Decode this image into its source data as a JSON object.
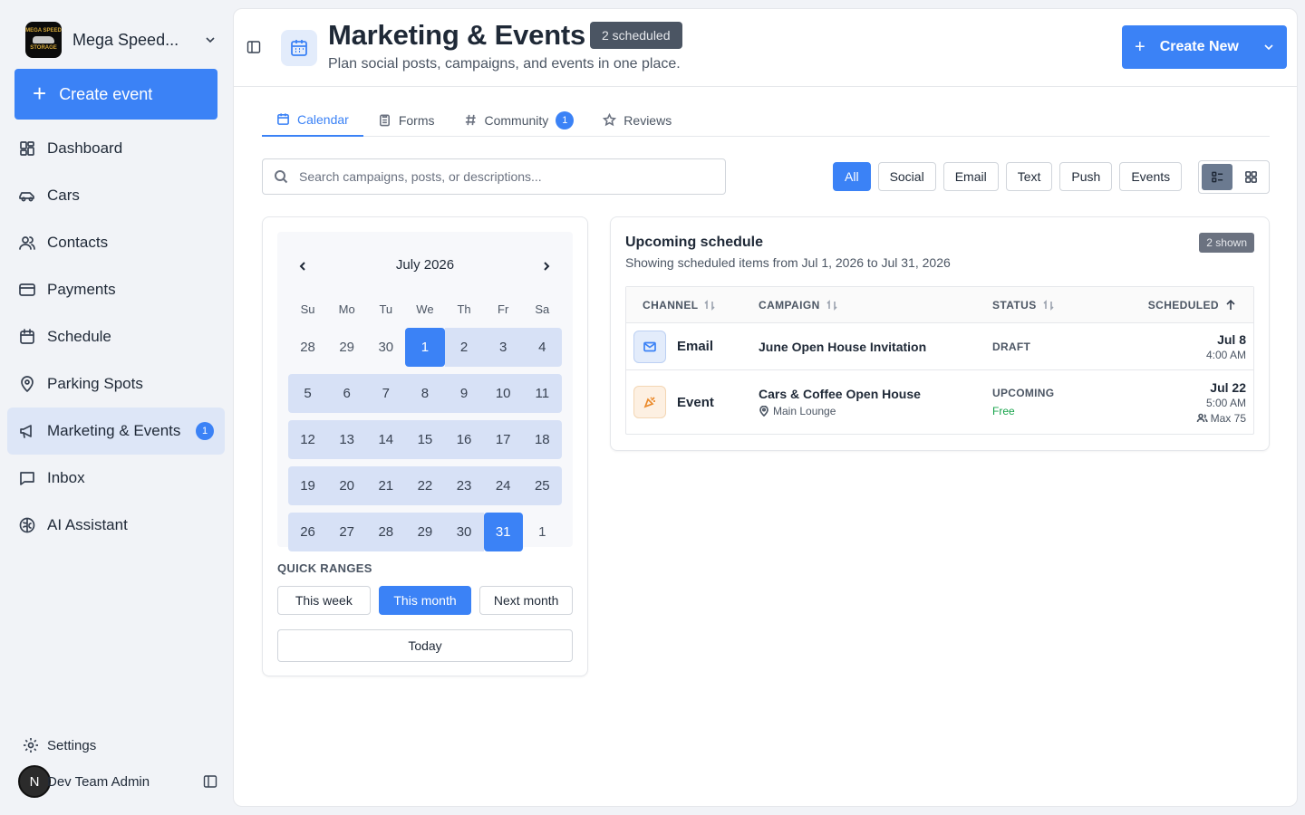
{
  "brand": {
    "name": "Mega Speed...",
    "logo_text_top": "MEGA SPEED",
    "logo_text_bottom": "STORAGE"
  },
  "sidebar": {
    "create_label": "Create event",
    "items": [
      {
        "label": "Dashboard",
        "icon": "dashboard-icon"
      },
      {
        "label": "Cars",
        "icon": "car-icon"
      },
      {
        "label": "Contacts",
        "icon": "contacts-icon"
      },
      {
        "label": "Payments",
        "icon": "credit-card-icon"
      },
      {
        "label": "Schedule",
        "icon": "calendar-icon"
      },
      {
        "label": "Parking Spots",
        "icon": "map-pin-icon"
      },
      {
        "label": "Marketing & Events",
        "icon": "megaphone-icon",
        "badge": "1",
        "active": true
      },
      {
        "label": "Inbox",
        "icon": "message-icon"
      },
      {
        "label": "AI Assistant",
        "icon": "brain-icon"
      }
    ],
    "settings_label": "Settings",
    "user_initial": "N",
    "user_name": "Dev Team Admin"
  },
  "header": {
    "title": "Marketing & Events",
    "badge": "2 scheduled",
    "subtitle": "Plan social posts, campaigns, and events in one place.",
    "create_new_label": "Create New"
  },
  "tabs": [
    {
      "label": "Calendar",
      "active": true
    },
    {
      "label": "Forms"
    },
    {
      "label": "Community",
      "badge": "1"
    },
    {
      "label": "Reviews"
    }
  ],
  "search": {
    "placeholder": "Search campaigns, posts, or descriptions..."
  },
  "filters": [
    "All",
    "Social",
    "Email",
    "Text",
    "Push",
    "Events"
  ],
  "calendar": {
    "month_label": "July 2026",
    "weekdays": [
      "Su",
      "Mo",
      "Tu",
      "We",
      "Th",
      "Fr",
      "Sa"
    ],
    "weeks": [
      [
        "28",
        "29",
        "30",
        "1",
        "2",
        "3",
        "4"
      ],
      [
        "5",
        "6",
        "7",
        "8",
        "9",
        "10",
        "11"
      ],
      [
        "12",
        "13",
        "14",
        "15",
        "16",
        "17",
        "18"
      ],
      [
        "19",
        "20",
        "21",
        "22",
        "23",
        "24",
        "25"
      ],
      [
        "26",
        "27",
        "28",
        "29",
        "30",
        "31",
        "1"
      ]
    ],
    "range_start": "July 1, 2026",
    "range_end": "July 31, 2026",
    "quick_label": "QUICK RANGES",
    "quick_ranges": [
      "This week",
      "This month",
      "Next month"
    ],
    "active_quick": "This month",
    "today_label": "Today"
  },
  "schedule": {
    "title": "Upcoming schedule",
    "subtitle": "Showing scheduled items from Jul 1, 2026 to Jul 31, 2026",
    "shown_badge": "2 shown",
    "columns": [
      "CHANNEL",
      "CAMPAIGN",
      "STATUS",
      "SCHEDULED"
    ],
    "rows": [
      {
        "channel": "Email",
        "campaign": "June Open House Invitation",
        "status": "DRAFT",
        "date": "Jul 8",
        "time": "4:00 AM"
      },
      {
        "channel": "Event",
        "campaign": "Cars & Coffee Open House",
        "location": "Main Lounge",
        "status": "UPCOMING",
        "price": "Free",
        "date": "Jul 22",
        "time": "5:00 AM",
        "capacity": "Max 75"
      }
    ]
  },
  "colors": {
    "accent": "#3b82f6",
    "active_nav_bg": "#dde6f7",
    "range_bg": "#d7e1f6",
    "free_green": "#16a34a"
  }
}
